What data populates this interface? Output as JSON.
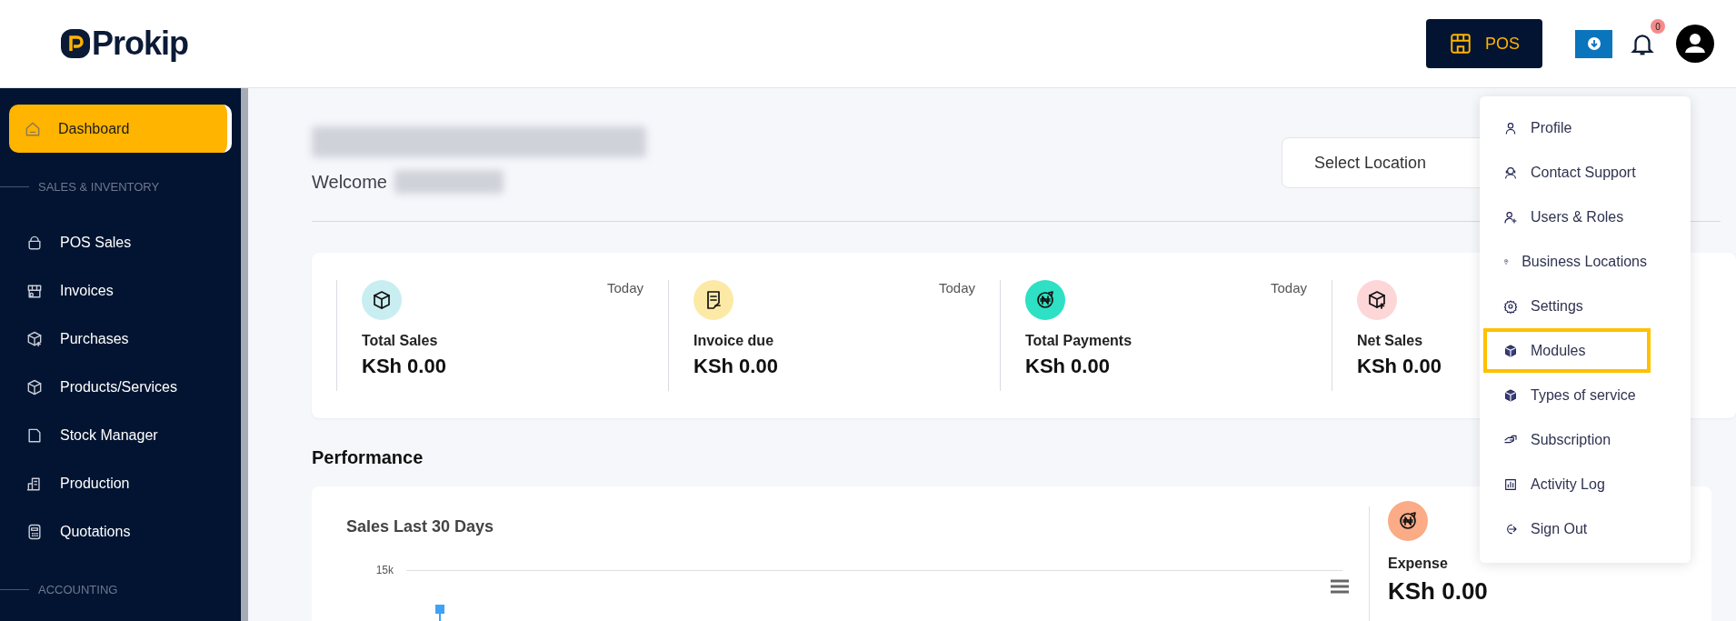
{
  "header": {
    "logo": "Prokip",
    "pos_button": "POS",
    "notification_count": "0"
  },
  "sidebar": {
    "items": [
      {
        "kind": "item",
        "label": "Dashboard",
        "selected": true
      },
      {
        "kind": "section",
        "label": "SALES & INVENTORY"
      },
      {
        "kind": "item",
        "label": "POS Sales",
        "selected": false
      },
      {
        "kind": "item",
        "label": "Invoices",
        "selected": false
      },
      {
        "kind": "item",
        "label": "Purchases",
        "selected": false
      },
      {
        "kind": "item",
        "label": "Products/Services",
        "selected": false
      },
      {
        "kind": "item",
        "label": "Stock Manager",
        "selected": false
      },
      {
        "kind": "item",
        "label": "Production",
        "selected": false
      },
      {
        "kind": "item",
        "label": "Quotations",
        "selected": false
      },
      {
        "kind": "section",
        "label": "ACCOUNTING"
      }
    ]
  },
  "page": {
    "welcome": "Welcome",
    "location_button": "Select Location"
  },
  "stats": [
    {
      "label": "Total Sales",
      "value": "KSh 0.00",
      "period": "Today",
      "color": "#c9eef2"
    },
    {
      "label": "Invoice due",
      "value": "KSh 0.00",
      "period": "Today",
      "color": "#fde9a6"
    },
    {
      "label": "Total Payments",
      "value": "KSh 0.00",
      "period": "Today",
      "color": "#2ee0c4"
    },
    {
      "label": "Net Sales",
      "value": "KSh 0.00",
      "color": "#fdd6d8"
    }
  ],
  "performance": {
    "heading": "Performance",
    "chart_title": "Sales Last 30 Days",
    "y_tick": "15k",
    "side_stat": {
      "label": "Expense",
      "value": "KSh 0.00"
    }
  },
  "user_menu": {
    "items": [
      {
        "label": "Profile",
        "highlighted": false
      },
      {
        "label": "Contact Support",
        "highlighted": false
      },
      {
        "label": "Users & Roles",
        "highlighted": false
      },
      {
        "label": "Business Locations",
        "highlighted": false
      },
      {
        "label": "Settings",
        "highlighted": false
      },
      {
        "label": "Modules",
        "highlighted": true
      },
      {
        "label": "Types of service",
        "highlighted": false
      },
      {
        "label": "Subscription",
        "highlighted": false
      },
      {
        "label": "Activity Log",
        "highlighted": false
      },
      {
        "label": "Sign Out",
        "highlighted": false
      }
    ]
  }
}
